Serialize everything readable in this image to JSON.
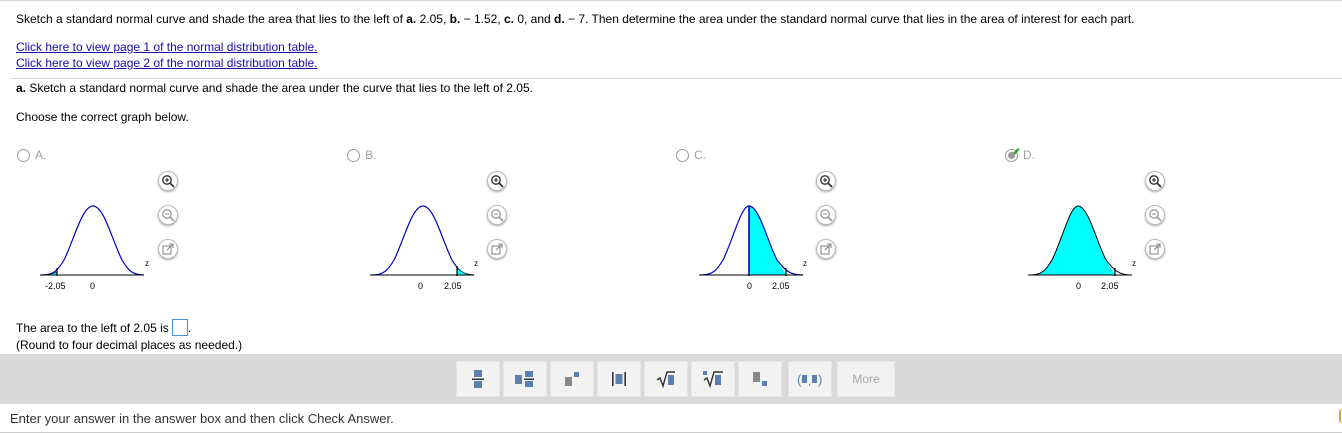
{
  "question": {
    "intro": "Sketch a standard normal curve and shade the area that lies to the left of ",
    "a_label": "a.",
    "a_val": " 2.05, ",
    "b_label": "b.",
    "b_val": " − 1.52, ",
    "c_label": "c.",
    "c_val": " 0, and ",
    "d_label": "d.",
    "d_val": " − 7",
    "outro": ". Then determine the area under the standard normal curve that lies in the area of interest for each part."
  },
  "links": {
    "page1": "Click here to view page 1 of the normal distribution table.",
    "page2": "Click here to view page 2 of the normal distribution table."
  },
  "part_a": {
    "label": "a.",
    "text": " Sketch a standard normal curve and shade the area under the curve that lies to the left of 2.05."
  },
  "choose_text": "Choose the correct graph below.",
  "options": [
    {
      "label": "A.",
      "ticks": [
        "-2.05",
        "0"
      ],
      "axis_label": "z",
      "selected": false
    },
    {
      "label": "B.",
      "ticks": [
        "0",
        "2.05"
      ],
      "axis_label": "z",
      "selected": false
    },
    {
      "label": "C.",
      "ticks": [
        "0",
        "2.05"
      ],
      "axis_label": "z",
      "selected": false
    },
    {
      "label": "D.",
      "ticks": [
        "0",
        "2.05"
      ],
      "axis_label": "z",
      "selected": true
    }
  ],
  "answer": {
    "prompt": "The area to the left of 2.05 is",
    "suffix": ".",
    "value": "",
    "hint": "(Round to four decimal places as needed.)"
  },
  "toolbar": {
    "more_label": "More",
    "buttons": [
      "fraction-icon",
      "mixed-number-icon",
      "exponent-icon",
      "absolute-value-icon",
      "square-root-icon",
      "nth-root-icon",
      "subscript-icon",
      "ordered-pair-icon"
    ]
  },
  "footer": {
    "text": "Enter your answer in the answer box and then click Check Answer."
  },
  "colors": {
    "shade": "#00ffff",
    "curve": "#0000cc",
    "link": "#1a0dab",
    "check": "#2a9d2a",
    "toolbar_bg": "#d9d9d9"
  }
}
